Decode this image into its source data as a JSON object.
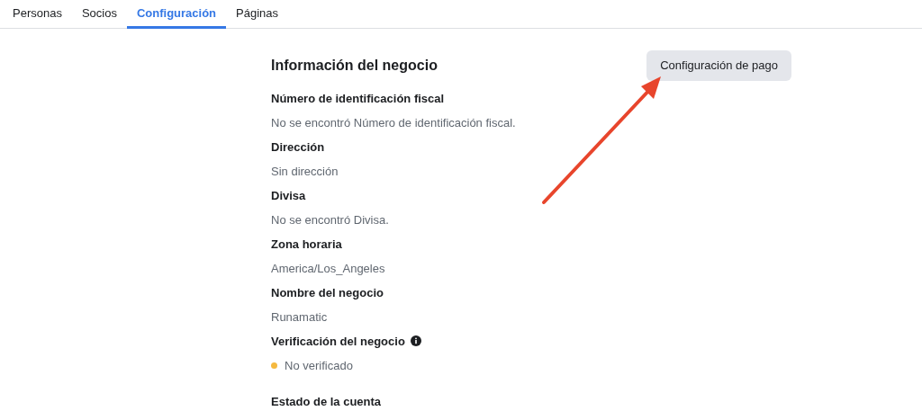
{
  "tabs": [
    {
      "label": "Personas",
      "selected": false
    },
    {
      "label": "Socios",
      "selected": false
    },
    {
      "label": "Configuración",
      "selected": true
    },
    {
      "label": "Páginas",
      "selected": false
    }
  ],
  "section": {
    "title": "Información del negocio",
    "button": "Configuración de pago",
    "fields": [
      {
        "label": "Número de identificación fiscal",
        "value": "No se encontró Número de identificación fiscal."
      },
      {
        "label": "Dirección",
        "value": "Sin dirección"
      },
      {
        "label": "Divisa",
        "value": "No se encontró Divisa."
      },
      {
        "label": "Zona horaria",
        "value": "America/Los_Angeles"
      },
      {
        "label": "Nombre del negocio",
        "value": "Runamatic"
      },
      {
        "label": "Verificación del negocio",
        "info": true,
        "value": "No verificado",
        "color": "#f5b93f"
      },
      {
        "label": "Estado de la cuenta"
      }
    ]
  }
}
